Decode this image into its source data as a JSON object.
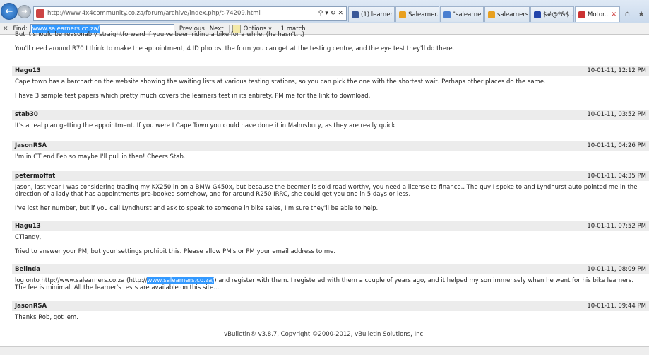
{
  "browser": {
    "url": "http://www.4x4community.co.za/forum/archive/index.php/t-74209.html",
    "tabs": [
      {
        "label": "(1) learner...",
        "color": "#3b5998"
      },
      {
        "label": "Salearner...",
        "color": "#e8a020"
      },
      {
        "label": "\"salearner...",
        "color": "#4a7fd0"
      },
      {
        "label": "salearners...",
        "color": "#e8a020"
      },
      {
        "label": "$#@*&$ ...",
        "color": "#2244aa"
      },
      {
        "label": "Motor...",
        "color": "#cc3333"
      }
    ]
  },
  "findbar": {
    "label": "Find:",
    "query": "www.salearners.co.za/",
    "prev_label": "Previous",
    "next_label": "Next",
    "options_label": "Options",
    "match_count": "1 match"
  },
  "posts": [
    {
      "author": "",
      "date": "",
      "paragraphs": [
        "But it should be reasonably straightforward if you've been riding a bike for a while. (he hasn't...)",
        "You'll need around R70 I think to make the appointment, 4 ID photos, the form you can get at the testing centre, and the eye test they'll do there."
      ]
    },
    {
      "author": "Hagu13",
      "date": "10-01-11, 12:12 PM",
      "paragraphs": [
        "Cape town has a barchart on the website showing the waiting lists at various testing stations, so you can pick the one with the shortest wait. Perhaps other places do the same.",
        "I have 3 sample test papers which pretty much covers the learners test in its entirety. PM me for the link to download."
      ]
    },
    {
      "author": "stab30",
      "date": "10-01-11, 03:52 PM",
      "paragraphs": [
        "It's a real pian getting the appointment. If you were I Cape Town you could have done it in Malmsbury, as they are really quick"
      ]
    },
    {
      "author": "JasonRSA",
      "date": "10-01-11, 04:26 PM",
      "paragraphs": [
        "I'm in CT end Feb so maybe I'll pull in then! Cheers Stab."
      ]
    },
    {
      "author": "petermoffat",
      "date": "10-01-11, 04:35 PM",
      "paragraphs": [
        "Jason, last year I was considering trading my KX250 in on a BMW G450x, but because the beemer is sold road worthy, you need a license to finance.. The guy I spoke to and Lyndhurst auto pointed me in the direction of a lady that has appointments pre-booked somehow, and for around R250 IRRC, she could get you one in 5 days or less.",
        "I've lost her number, but if you call Lyndhurst and ask to speak to someone in bike sales, I'm sure they'll be able to help."
      ]
    },
    {
      "author": "Hagu13",
      "date": "10-01-11, 07:52 PM",
      "paragraphs": [
        "CTlandy,",
        "Tried to answer your PM, but your settings prohibit this. Please allow PM's or PM your email address to me."
      ]
    },
    {
      "author": "Belinda",
      "date": "10-01-11, 08:09 PM",
      "body_pre": "log onto http://www.salearners.co.za (http://",
      "body_hl": "www.salearners.co.za/",
      "body_post": ") and register with them. I registered with them a couple of years ago, and it helped my son immensely when he went for his bike learners. The fee is minimal. All the learner's tests are available on this site..."
    },
    {
      "author": "JasonRSA",
      "date": "10-01-11, 09:44 PM",
      "paragraphs": [
        "Thanks Rob, got 'em."
      ]
    }
  ],
  "footer": "vBulletin® v3.8.7, Copyright ©2000-2012, vBulletin Solutions, Inc."
}
